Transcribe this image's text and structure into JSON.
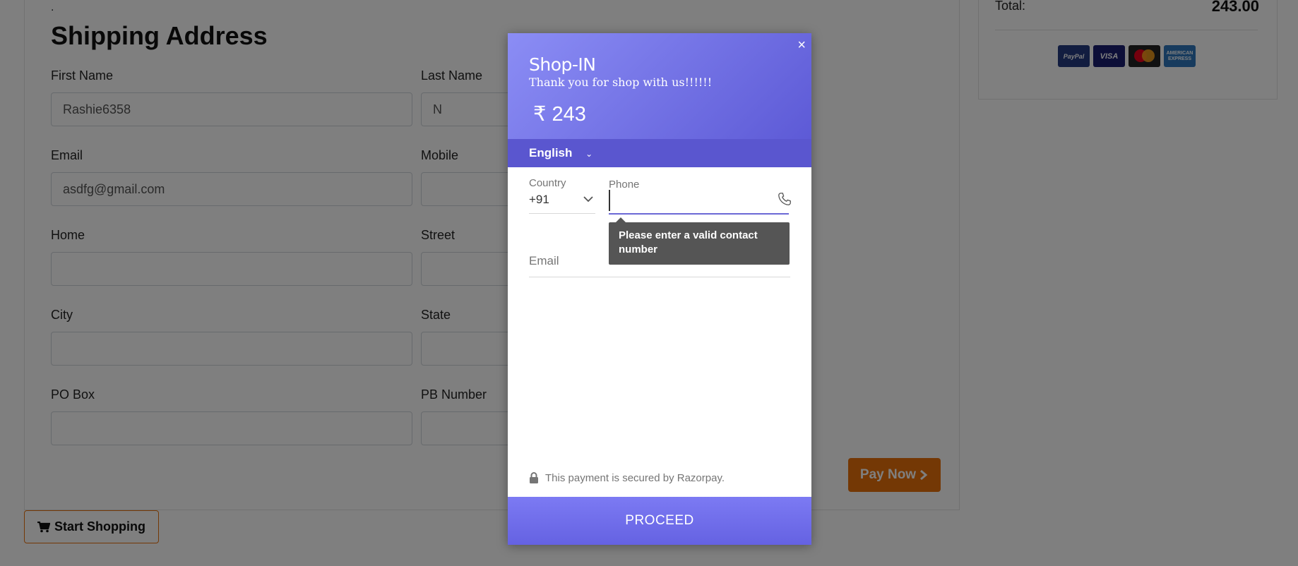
{
  "shipping": {
    "dot": ".",
    "title": "Shipping Address",
    "labels": {
      "first_name": "First Name",
      "last_name": "Last Name",
      "email": "Email",
      "mobile": "Mobile",
      "home": "Home",
      "street": "Street",
      "city": "City",
      "state": "State",
      "po_box": "PO Box",
      "pb_number": "PB Number"
    },
    "values": {
      "first_name": "Rashie6358",
      "last_name": "N",
      "email": "asdfg@gmail.com",
      "mobile": "",
      "home": "",
      "street": "",
      "city": "",
      "state": "",
      "po_box": "",
      "pb_number": ""
    }
  },
  "summary": {
    "total_label": "Total:",
    "total_value": "243.00",
    "payment_icons": [
      "paypal-icon",
      "visa-icon",
      "mastercard-icon",
      "amex-icon"
    ],
    "paypal_text": "PayPal",
    "visa_text": "VISA",
    "amex_text": "AMERICAN EXPRESS"
  },
  "buttons": {
    "pay_now": "Pay Now",
    "start_shopping": "Start Shopping"
  },
  "modal": {
    "close": "×",
    "merchant_name": "Shop-IN",
    "description": "Thank you for shop with us!!!!!!",
    "amount": "₹ 243",
    "language": "English",
    "country_label": "Country",
    "country_code": "+91",
    "phone_label": "Phone",
    "phone_value": "",
    "tooltip": "Please enter a valid contact number",
    "email_label": "Email",
    "secure_text": "This payment is secured by Razorpay.",
    "proceed": "PROCEED"
  },
  "colors": {
    "accent_orange": "#e8700a",
    "razorpay_purple": "#6562e2",
    "lang_bar": "#5a56cf"
  }
}
